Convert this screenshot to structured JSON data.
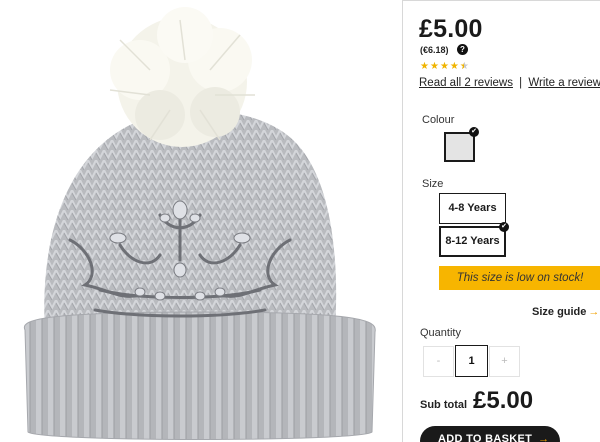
{
  "product": {
    "image_alt": "knitted-bobble-hat-with-crown-embellishment"
  },
  "pricing": {
    "price": "£5.00",
    "price_eur": "(€6.18)",
    "help_icon": "?"
  },
  "rating": {
    "stars": 4.5,
    "max": 5,
    "read_reviews_label": "Read all 2 reviews",
    "separator": "|",
    "write_review_label": "Write a review"
  },
  "colour": {
    "label": "Colour",
    "selected_swatch": "#e4e4e4"
  },
  "size": {
    "label": "Size",
    "options": [
      "4-8 Years",
      "8-12 Years"
    ],
    "selected": "8-12 Years",
    "low_stock_message": "This size is low on stock!"
  },
  "size_guide": {
    "label": "Size guide",
    "arrow": "→"
  },
  "quantity": {
    "label": "Quantity",
    "minus": "-",
    "value": "1",
    "plus": "+"
  },
  "subtotal": {
    "label": "Sub total",
    "value": "£5.00"
  },
  "basket": {
    "label": "ADD TO BASKET",
    "arrow": "→"
  },
  "colors": {
    "accent": "#f7b500",
    "dark": "#1a1a1a",
    "star": "#f0b400"
  }
}
